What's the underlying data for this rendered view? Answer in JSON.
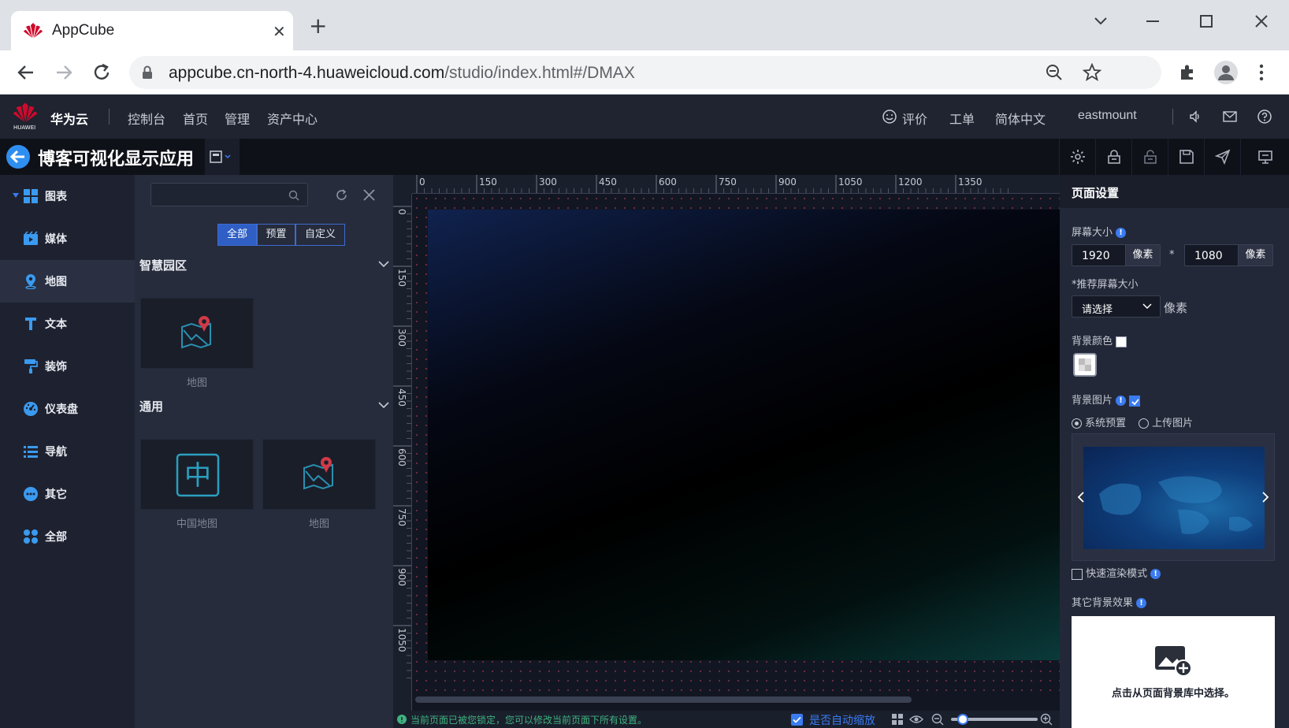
{
  "browser": {
    "tab_title": "AppCube",
    "url_host": "appcube.cn-north-4.huaweicloud.com",
    "url_path": "/studio/index.html#/DMAX"
  },
  "topnav": {
    "brand": "华为云",
    "logo_text": "HUAWEI",
    "items": [
      "控制台",
      "首页",
      "管理",
      "资产中心"
    ],
    "right": {
      "feedback": "评价",
      "ticket": "工单",
      "language": "简体中文",
      "user": "eastmount"
    }
  },
  "editor": {
    "app_title": "博客可视化显示应用"
  },
  "categories": [
    {
      "label": "图表",
      "icon": "grid-icon"
    },
    {
      "label": "媒体",
      "icon": "media-icon"
    },
    {
      "label": "地图",
      "icon": "map-pin-icon"
    },
    {
      "label": "文本",
      "icon": "text-icon"
    },
    {
      "label": "装饰",
      "icon": "paint-roller-icon"
    },
    {
      "label": "仪表盘",
      "icon": "dashboard-icon"
    },
    {
      "label": "导航",
      "icon": "list-icon"
    },
    {
      "label": "其它",
      "icon": "more-icon"
    },
    {
      "label": "全部",
      "icon": "apps-icon"
    }
  ],
  "panel": {
    "filters": [
      "全部",
      "预置",
      "自定义"
    ],
    "groups": [
      {
        "title": "智慧园区",
        "items": [
          "地图"
        ]
      },
      {
        "title": "通用",
        "items": [
          "中国地图",
          "地图"
        ]
      }
    ]
  },
  "ruler": {
    "h_ticks": [
      "0",
      "150",
      "300",
      "450",
      "600",
      "750",
      "900",
      "1050",
      "1200",
      "1350"
    ],
    "v_ticks": [
      "0",
      "150",
      "300",
      "450",
      "600",
      "750",
      "900",
      "1050"
    ]
  },
  "status": {
    "message": "当前页面已被您锁定，您可以修改当前页面下所有设置。",
    "auto_zoom": "是否自动缩放"
  },
  "props": {
    "title": "页面设置",
    "screen_size_label": "屏幕大小",
    "width": "1920",
    "height": "1080",
    "unit": "像素",
    "times": "*",
    "recommended_label": "*推荐屏幕大小",
    "select_placeholder": "请选择",
    "bg_color_label": "背景颜色",
    "bg_image_label": "背景图片",
    "radio_system": "系统预置",
    "radio_upload": "上传图片",
    "fast_render": "快速渲染模式",
    "other_effects": "其它背景效果",
    "upload_hint": "点击从页面背景库中选择。"
  },
  "colors": {
    "accent": "#2f5fc4",
    "status_green": "#3fb27f",
    "link_blue": "#3a7bf0"
  }
}
